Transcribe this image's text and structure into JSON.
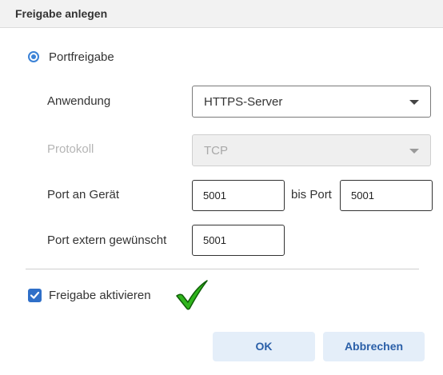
{
  "dialog": {
    "title": "Freigabe anlegen"
  },
  "mode": {
    "label": "Portfreigabe",
    "selected": true
  },
  "fields": {
    "application": {
      "label": "Anwendung",
      "value": "HTTPS-Server"
    },
    "protocol": {
      "label": "Protokoll",
      "value": "TCP",
      "disabled": true
    },
    "device_port": {
      "label": "Port an Gerät",
      "from": "5001",
      "to_label": "bis Port",
      "to": "5001"
    },
    "external_port": {
      "label": "Port extern gewünscht",
      "value": "5001"
    }
  },
  "activate": {
    "label": "Freigabe aktivieren",
    "checked": true
  },
  "buttons": {
    "ok": "OK",
    "cancel": "Abbrechen"
  },
  "colors": {
    "accent": "#3b82d6",
    "button_bg": "#e4eef9",
    "button_text": "#2a5fa8",
    "status_check": "#2fb51c"
  }
}
